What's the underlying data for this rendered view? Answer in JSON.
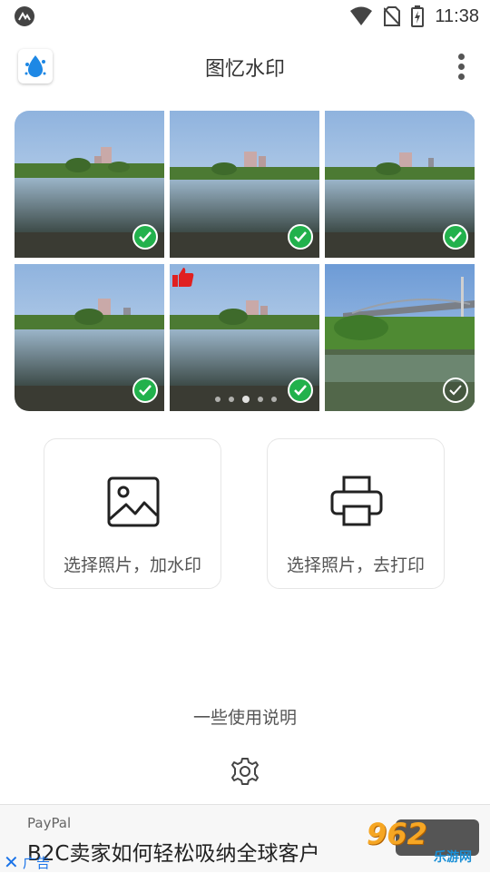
{
  "status_bar": {
    "time": "11:38"
  },
  "app_bar": {
    "title": "图忆水印"
  },
  "photo_grid": {
    "tiles": [
      {
        "scene": "pond",
        "selected": true
      },
      {
        "scene": "pond",
        "selected": true
      },
      {
        "scene": "pond",
        "selected": true
      },
      {
        "scene": "pond",
        "selected": true
      },
      {
        "scene": "pond",
        "selected": true,
        "liked": true
      },
      {
        "scene": "bridge",
        "selected": false
      }
    ],
    "page_count": 5,
    "active_page": 2
  },
  "actions": {
    "watermark_label": "选择照片，加水印",
    "print_label": "选择照片，去打印"
  },
  "help_link": "一些使用说明",
  "ad": {
    "sponsor": "PayPal",
    "text": "B2C卖家如何轻松吸纳全球客户",
    "tag": "广告"
  },
  "watermark": {
    "brand": "962",
    "sub": "乐游网"
  },
  "colors": {
    "check_green": "#22b14c",
    "like_red": "#e02020",
    "logo_blue": "#1e88e5"
  }
}
